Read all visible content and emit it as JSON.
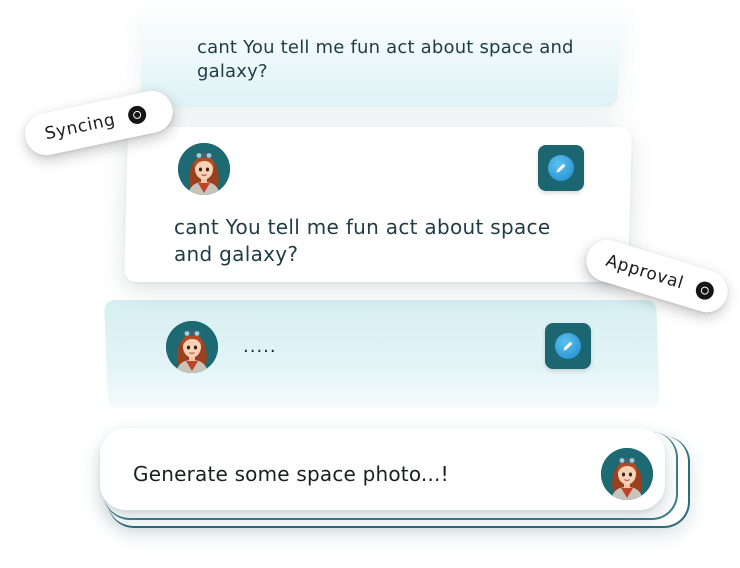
{
  "messages": {
    "previous_prompt": "cant You tell me fun  act about space and galaxy?",
    "current_prompt": "cant You tell me fun  act about space and galaxy?",
    "typing_indicator": "....."
  },
  "composer": {
    "input_value": "Generate some space photo...!"
  },
  "badges": {
    "syncing": "Syncing",
    "approval": "Approval"
  },
  "icons": {
    "avatar": "user-avatar-icon",
    "edit": "pencil-edit-icon",
    "status": "status-ring-icon"
  },
  "colors": {
    "accent_teal": "#1b6670",
    "edit_blue": "#2f9ad6",
    "card_teal": "#d6eff3",
    "text_dark": "#1f3c44"
  }
}
